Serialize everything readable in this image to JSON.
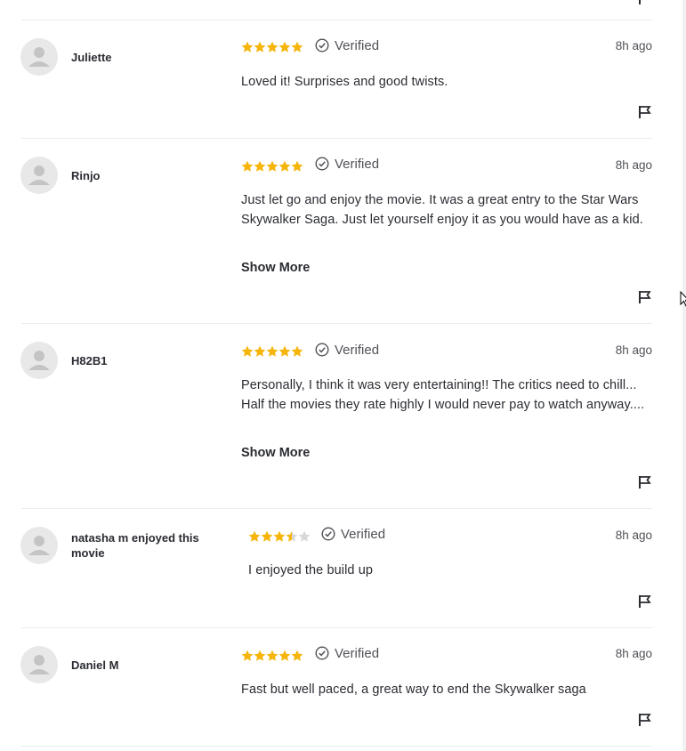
{
  "colors": {
    "star_fill": "#f5b50a",
    "star_empty": "#d8d8d8",
    "divider": "#ececec",
    "text": "#2a2c32",
    "muted": "#505257"
  },
  "icons": {
    "avatar": "person-silhouette-icon",
    "verified": "check-circle-icon",
    "flag": "flag-icon",
    "star": "star-icon"
  },
  "reviews": [
    {
      "user": "Juliette",
      "rating": 5,
      "verified_label": "Verified",
      "time": "8h ago",
      "text": "Loved it! Surprises and good twists.",
      "show_more": ""
    },
    {
      "user": "Rinjo",
      "rating": 5,
      "verified_label": "Verified",
      "time": "8h ago",
      "text": "Just let go and enjoy the movie. It was a great entry to the Star Wars Skywalker Saga. Just let yourself enjoy it as you would have as a kid.",
      "show_more": "Show More"
    },
    {
      "user": "H82B1",
      "rating": 5,
      "verified_label": "Verified",
      "time": "8h ago",
      "text": "Personally, I think it was very entertaining!! The critics need to chill... Half the movies they rate highly I would never pay to watch anyway....",
      "show_more": "Show More"
    },
    {
      "user": "natasha m enjoyed this movie",
      "rating": 3.5,
      "verified_label": "Verified",
      "time": "8h ago",
      "text": "I enjoyed the build up",
      "show_more": ""
    },
    {
      "user": "Daniel M",
      "rating": 5,
      "verified_label": "Verified",
      "time": "8h ago",
      "text": "Fast but well paced, a great way to end the Skywalker saga",
      "show_more": ""
    }
  ]
}
